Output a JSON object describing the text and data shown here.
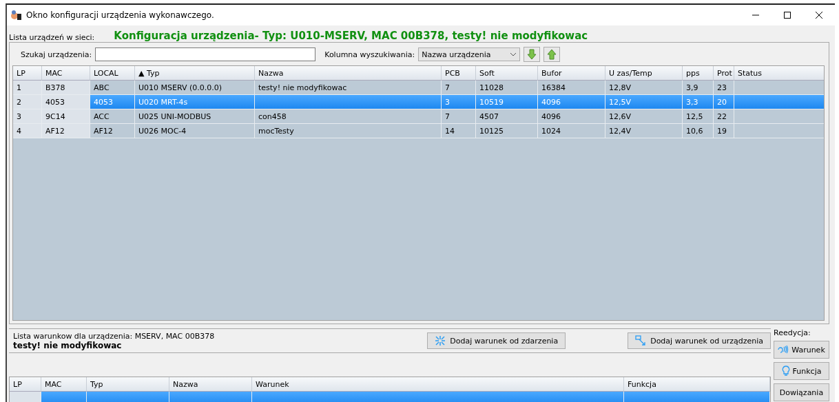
{
  "window": {
    "title": "Okno konfiguracji urządzenia wykonawczego."
  },
  "devices_label": "Lista urządzeń w sieci:",
  "config_title": "Konfiguracja urządzenia- Typ: U010-MSERV, MAC 00B378, testy! nie modyfikowac",
  "search": {
    "label": "Szukaj urządzenia:",
    "column_label": "Kolumna wyszukiwania:",
    "column_value": "Nazwa urządzenia"
  },
  "devices_table": {
    "columns": [
      "LP",
      "MAC",
      "LOCAL",
      "▲ Typ",
      "Nazwa",
      "PCB",
      "Soft",
      "Bufor",
      "U zas/Temp",
      "pps",
      "Prot",
      "Status"
    ],
    "rows": [
      {
        "selected": false,
        "cells": [
          "1",
          "B378",
          "ABC",
          "U010 MSERV (0.0.0.0)",
          "testy! nie modyfikowac",
          "7",
          "11028",
          "16384",
          "12,8V",
          "3,9",
          "23",
          ""
        ]
      },
      {
        "selected": true,
        "cells": [
          "2",
          "4053",
          "4053",
          "U020 MRT-4s",
          "",
          "3",
          "10519",
          "4096",
          "12,5V",
          "3,3",
          "20",
          ""
        ]
      },
      {
        "selected": false,
        "cells": [
          "3",
          "9C14",
          "ACC",
          "U025 UNI-MODBUS",
          "con458",
          "7",
          "4507",
          "4096",
          "12,6V",
          "12,5",
          "22",
          ""
        ]
      },
      {
        "selected": false,
        "cells": [
          "4",
          "AF12",
          "AF12",
          "U026 MOC-4",
          "mocTesty",
          "14",
          "10125",
          "1024",
          "12,4V",
          "10,6",
          "19",
          ""
        ]
      }
    ]
  },
  "conditions_info": {
    "line": "Lista warunkow dla urządzenia: MSERV, MAC 00B378",
    "name": "testy! nie modyfikowac"
  },
  "add_buttons": [
    {
      "kind": "event",
      "label": "Dodaj warunek od zdarzenia"
    },
    {
      "kind": "device",
      "label": "Dodaj warunek od urządzenia"
    }
  ],
  "edit_panel": {
    "label": "Reedycja:",
    "buttons": [
      {
        "kind": "condition",
        "label": "Warunek"
      },
      {
        "kind": "function",
        "label": "Funkcja"
      },
      {
        "kind": "plain",
        "label": "Dowiązania"
      }
    ]
  },
  "conditions_table": {
    "columns": [
      "LP",
      "MAC",
      "Typ",
      "Nazwa",
      "Warunek",
      "Funkcja"
    ],
    "rows": [
      {
        "selected": true
      }
    ]
  }
}
